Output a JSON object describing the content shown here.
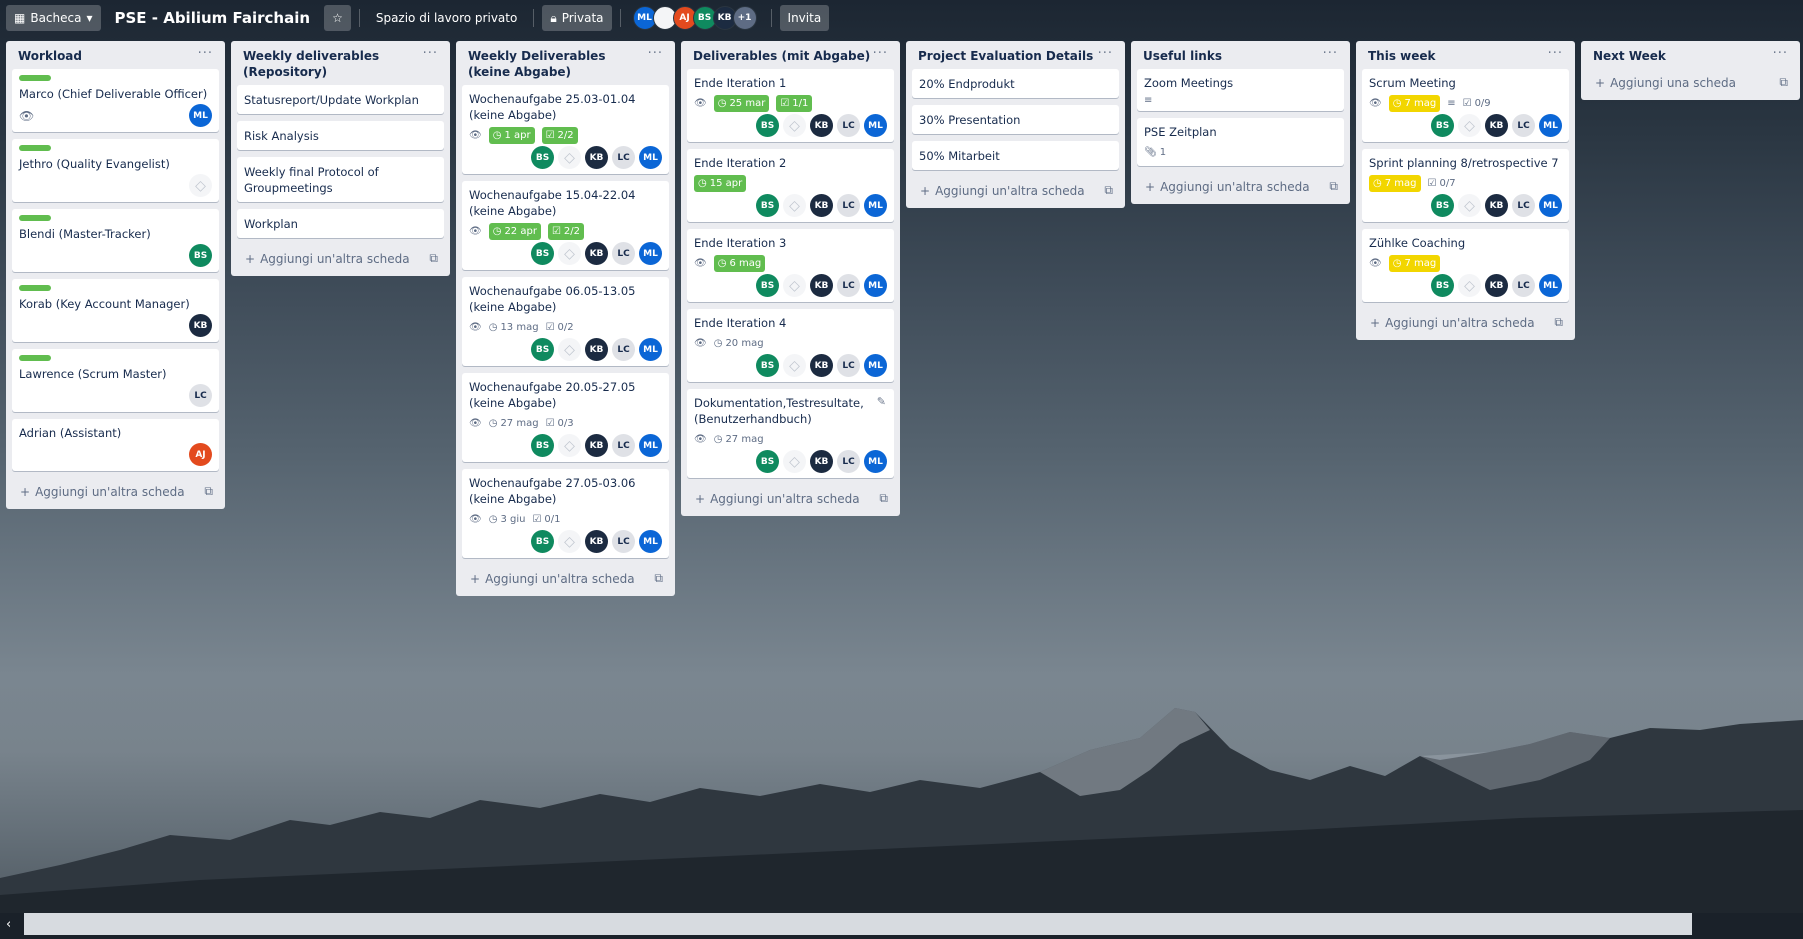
{
  "header": {
    "board_button": "Bacheca",
    "board_title": "PSE - Abilium Fairchain",
    "workspace": "Spazio di lavoro privato",
    "visibility": "Privata",
    "members": [
      "ML",
      "",
      "AJ",
      "BS",
      "KB"
    ],
    "more_members": "+1",
    "invite": "Invita"
  },
  "add_card_label": "Aggiungi un'altra scheda",
  "add_first_card_label": "Aggiungi una scheda",
  "lists": [
    {
      "title": "Workload",
      "cards": [
        {
          "title": "Marco (Chief Deliverable Officer)"
        },
        {
          "title": "Jethro (Quality Evangelist)"
        },
        {
          "title": "Blendi (Master-Tracker)",
          "member": "BS"
        },
        {
          "title": "Korab (Key Account Manager)",
          "member": "KB"
        },
        {
          "title": "Lawrence (Scrum Master)",
          "member": "LC"
        },
        {
          "title": "Adrian (Assistant)",
          "member": "AJ"
        }
      ],
      "marco_member": "ML"
    },
    {
      "title": "Weekly deliverables (Repository)",
      "cards": [
        {
          "title": "Statusreport/Update Workplan"
        },
        {
          "title": "Risk Analysis"
        },
        {
          "title": "Weekly final Protocol of Groupmeetings"
        },
        {
          "title": "Workplan"
        }
      ]
    },
    {
      "title": "Weekly Deliverables (keine Abgabe)",
      "cards": [
        {
          "title": "Wochenaufgabe 25.03-01.04 (keine Abgabe)",
          "due": "1 apr",
          "check": "2/2"
        },
        {
          "title": "Wochenaufgabe 15.04-22.04 (keine Abgabe)",
          "due": "22 apr",
          "check": "2/2"
        },
        {
          "title": "Wochenaufgabe 06.05-13.05 (keine Abgabe)",
          "due": "13 mag",
          "check": "0/2"
        },
        {
          "title": "Wochenaufgabe 20.05-27.05 (keine Abgabe)",
          "due": "27 mag",
          "check": "0/3"
        },
        {
          "title": "Wochenaufgabe 27.05-03.06 (keine Abgabe)",
          "due": "3 giu",
          "check": "0/1"
        }
      ]
    },
    {
      "title": "Deliverables (mit Abgabe)",
      "cards": [
        {
          "title": "Ende Iteration 1",
          "due": "25 mar",
          "check": "1/1"
        },
        {
          "title": "Ende Iteration 2",
          "due": "15 apr"
        },
        {
          "title": "Ende Iteration 3",
          "due": "6 mag"
        },
        {
          "title": "Ende Iteration 4",
          "due": "20 mag"
        },
        {
          "title": "Dokumentation,Testresultate, (Benutzerhandbuch)",
          "due": "27 mag"
        }
      ]
    },
    {
      "title": "Project Evaluation Details",
      "cards": [
        {
          "title": "20% Endprodukt"
        },
        {
          "title": "30% Presentation"
        },
        {
          "title": "50% Mitarbeit"
        }
      ]
    },
    {
      "title": "Useful links",
      "cards": [
        {
          "title": "Zoom Meetings"
        },
        {
          "title": "PSE Zeitplan",
          "attachments": "1"
        }
      ]
    },
    {
      "title": "This week",
      "cards": [
        {
          "title": "Scrum Meeting",
          "due": "7 mag",
          "check": "0/9"
        },
        {
          "title": "Sprint planning 8/retrospective 7",
          "due": "7 mag",
          "check": "0/7"
        },
        {
          "title": "Zühlke Coaching",
          "due": "7 mag"
        }
      ]
    },
    {
      "title": "Next Week",
      "cards": []
    }
  ],
  "members": {
    "bs": "BS",
    "kb": "KB",
    "lc": "LC",
    "ml": "ML"
  },
  "colors": {
    "label_green": "#61bd4f",
    "due_yellow": "#f2d600",
    "bs": "#0f8a5f",
    "kb": "#1c2b41",
    "ml": "#0b66d6",
    "aj": "#e34a1e"
  }
}
